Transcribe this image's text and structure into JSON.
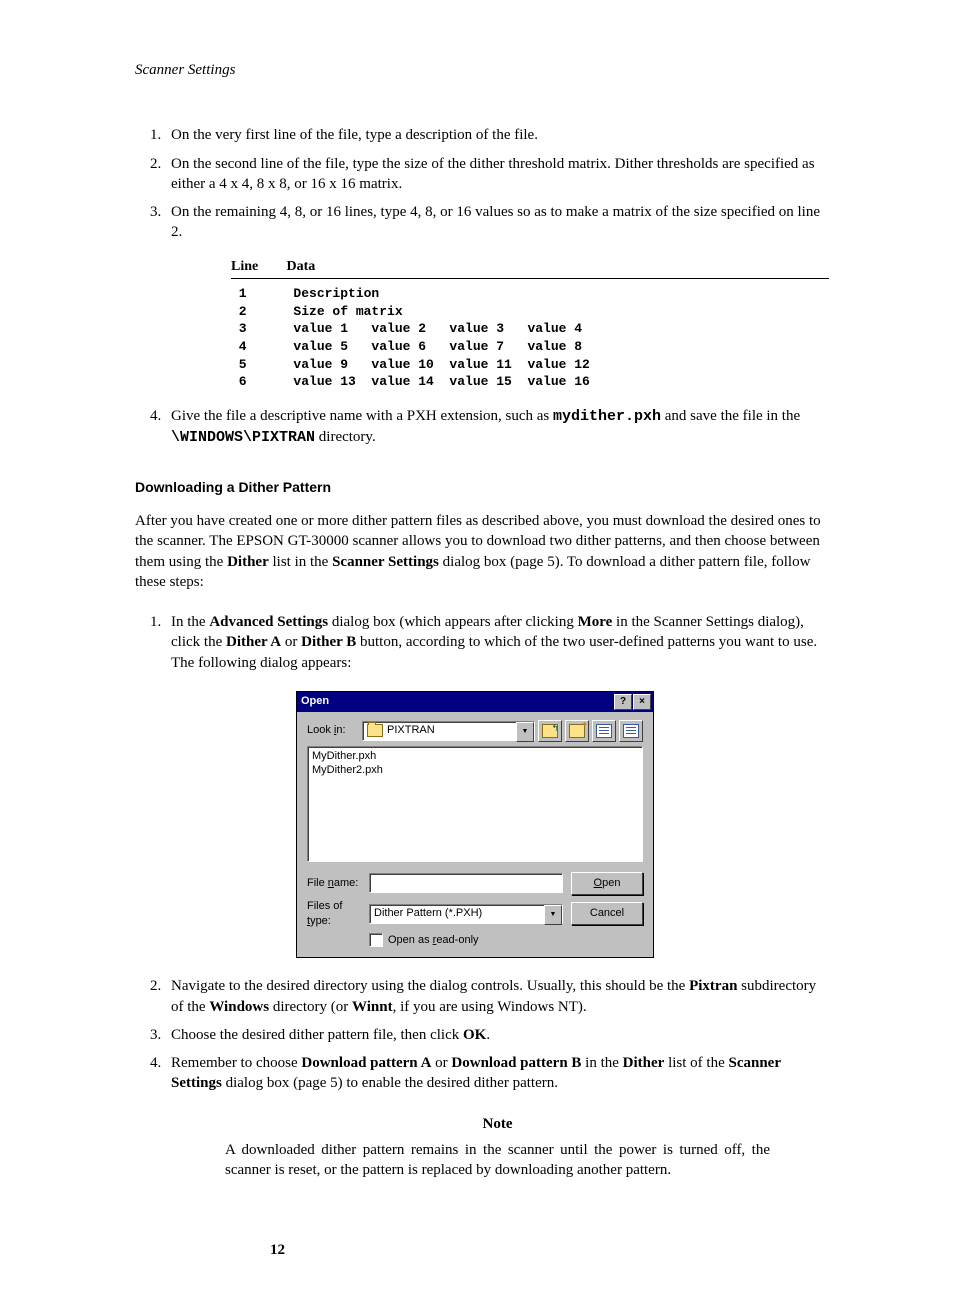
{
  "header": "Scanner Settings",
  "list1": {
    "i1": "On the very first line of the file, type a description of the file.",
    "i2": "On the second line of the file, type the size of the dither threshold matrix. Dither thresholds are specified as either a 4 x 4, 8 x 8, or 16 x 16 matrix.",
    "i3": "On the remaining 4, 8, or 16 lines, type 4, 8, or 16 values so as to make a matrix of the size specified on line 2.",
    "i4a": "Give the file a descriptive name with a PXH extension, such as ",
    "i4_file": "mydither.pxh",
    "i4b": " and save the file in the ",
    "i4_dir": "\\WINDOWS\\PIXTRAN",
    "i4c": " directory."
  },
  "format": {
    "h_line": "Line",
    "h_data": "Data",
    "rows": [
      " 1      Description",
      " 2      Size of matrix",
      " 3      value 1   value 2   value 3   value 4",
      " 4      value 5   value 6   value 7   value 8",
      " 5      value 9   value 10  value 11  value 12",
      " 6      value 13  value 14  value 15  value 16"
    ]
  },
  "subhead": "Downloading a Dither Pattern",
  "para": {
    "p1a": "After you have created one or more dither pattern files as described above, you must download the desired ones to the scanner. The EPSON GT-30000 scanner allows you to download two dither patterns, and then choose between them using the ",
    "p1_dither": "Dither",
    "p1b": " list in the ",
    "p1_ss": "Scanner Settings",
    "p1c": " dialog box (page 5). To download a dither pattern file, follow these steps:"
  },
  "list2": {
    "i1a": "In the ",
    "i1_as": "Advanced Settings",
    "i1b": " dialog box (which appears after clicking ",
    "i1_more": "More",
    "i1c": " in the Scanner Settings dialog), click the ",
    "i1_da": "Dither A",
    "i1d": " or ",
    "i1_db": "Dither B",
    "i1e": " button, according to which of the two user-defined patterns you want to use. The following dialog appears:",
    "i2a": "Navigate to the desired directory using the dialog controls. Usually, this should be the ",
    "i2_pix": "Pixtran",
    "i2b": " subdirectory of the ",
    "i2_win": "Windows",
    "i2c": " directory (or ",
    "i2_winnt": "Winnt",
    "i2d": ", if you are using Windows NT).",
    "i3a": "Choose the desired dither pattern file, then click ",
    "i3_ok": "OK",
    "i3b": ".",
    "i4a": "Remember to choose ",
    "i4_dpa": "Download pattern A",
    "i4b": " or ",
    "i4_dpb": "Download pattern B",
    "i4c": " in the ",
    "i4_d": "Dither",
    "i4d": " list of the ",
    "i4_ss": "Scanner Settings",
    "i4e": " dialog box (page 5) to enable the desired dither pattern."
  },
  "dialog": {
    "title": "Open",
    "lookin_label": "Look in:",
    "lookin_value": "PIXTRAN",
    "file1": "MyDither.pxh",
    "file2": "MyDither2.pxh",
    "filename_label": "File name:",
    "filename_value": "",
    "filetype_label": "Files of type:",
    "filetype_value": "Dither Pattern (*.PXH)",
    "open_btn": "Open",
    "cancel_btn": "Cancel",
    "readonly": "Open as read-only"
  },
  "note": {
    "title": "Note",
    "body": "A downloaded dither pattern remains in the scanner until the power is turned off, the scanner is reset, or the pattern is replaced by downloading another pattern."
  },
  "page_num": "12"
}
